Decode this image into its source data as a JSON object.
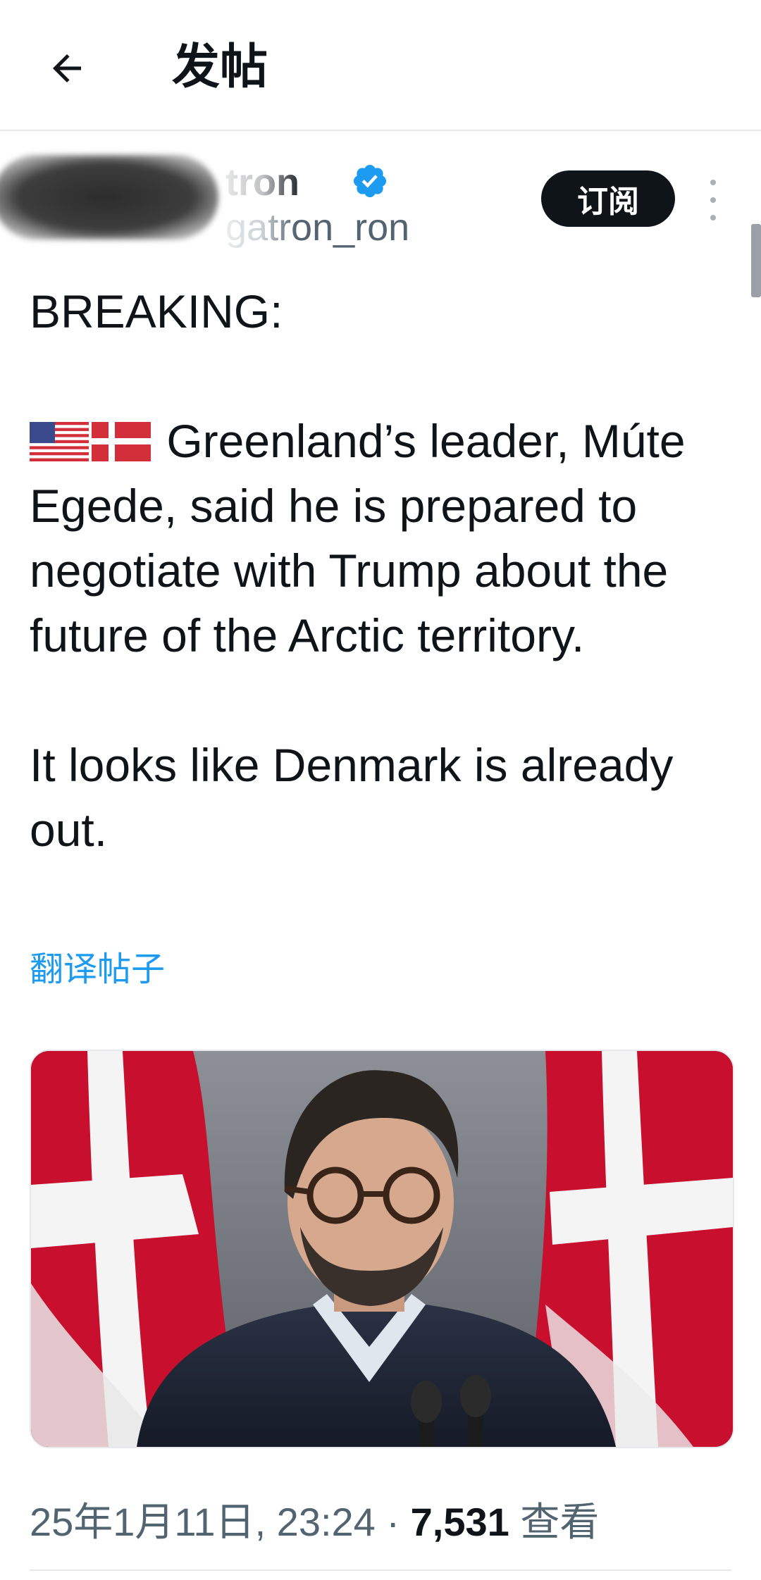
{
  "header": {
    "title": "发帖"
  },
  "author": {
    "display_name": "tron",
    "handle": "gatron_ron",
    "subscribe_label": "订阅"
  },
  "tweet": {
    "line_breaking": "BREAKING:",
    "line_main": "Greenland’s leader, Múte Egede, said he is prepared to negotiate with Trump about the future of the Arctic territory.",
    "line_followup": "It looks like Denmark is already out.",
    "translate_label": "翻译帖子"
  },
  "meta": {
    "timestamp": "25年1月11日, 23:24",
    "separator": "·",
    "views_count": "7,531",
    "views_label": "查看"
  },
  "colors": {
    "accent": "#1d9bf0",
    "text_primary": "#0f1419",
    "text_secondary": "#536471"
  },
  "icons": {
    "back": "arrow-left-icon",
    "verified": "verified-badge-icon",
    "more": "more-vertical-icon",
    "flags": [
      "us-flag-icon",
      "denmark-flag-icon"
    ]
  }
}
